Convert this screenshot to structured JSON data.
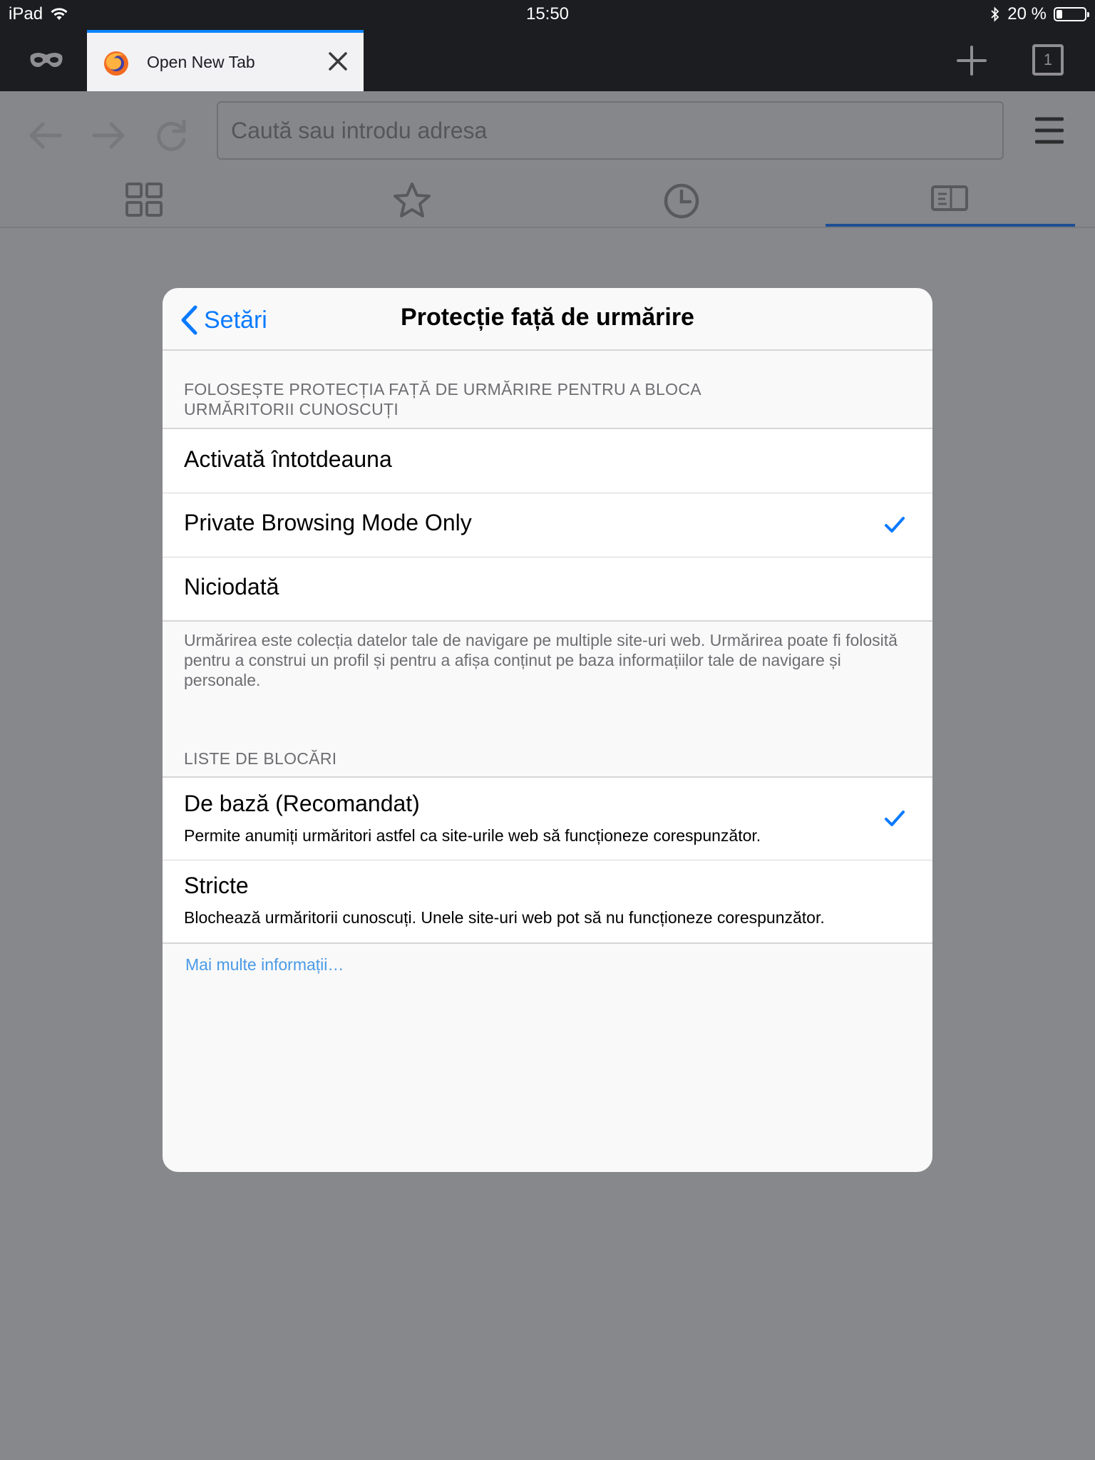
{
  "status_bar": {
    "device": "iPad",
    "time": "15:50",
    "battery_text": "20 %",
    "battery_level": 0.2
  },
  "tab": {
    "title": "Open New Tab"
  },
  "tabs_count": "1",
  "url_bar": {
    "placeholder": "Caută sau introdu adresa"
  },
  "modal": {
    "back_label": "Setări",
    "title": "Protecție față de urmărire",
    "tracking_section_header": "FOLOSEȘTE PROTECȚIA FAȚĂ DE URMĂRIRE PENTRU A BLOCA URMĂRITORII CUNOSCUȚI",
    "tracking_options": [
      {
        "label": "Activată întotdeauna",
        "selected": false
      },
      {
        "label": "Private Browsing Mode Only",
        "selected": true
      },
      {
        "label": "Niciodată",
        "selected": false
      }
    ],
    "tracking_footer": "Urmărirea este colecția datelor tale de navigare pe multiple site-uri web. Urmărirea poate fi folosită pentru a construi un profil și pentru a afișa conținut pe baza informațiilor tale de navigare și personale.",
    "blocklist_section_header": "LISTE DE BLOCĂRI",
    "blocklist_options": [
      {
        "label": "De bază (Recomandat)",
        "description": "Permite anumiți urmăritori astfel ca site-urile web să funcționeze corespunzător.",
        "selected": true
      },
      {
        "label": "Stricte",
        "description": "Blochează urmăritorii cunoscuți. Unele site-uri web pot să nu funcționeze corespunzător.",
        "selected": false
      }
    ],
    "more_info_link": "Mai multe informații…"
  },
  "colors": {
    "accent": "#0a7aff",
    "link": "#4a9ae6",
    "dimmed_background": "#87888c",
    "chrome_dark": "#1c1d21"
  }
}
